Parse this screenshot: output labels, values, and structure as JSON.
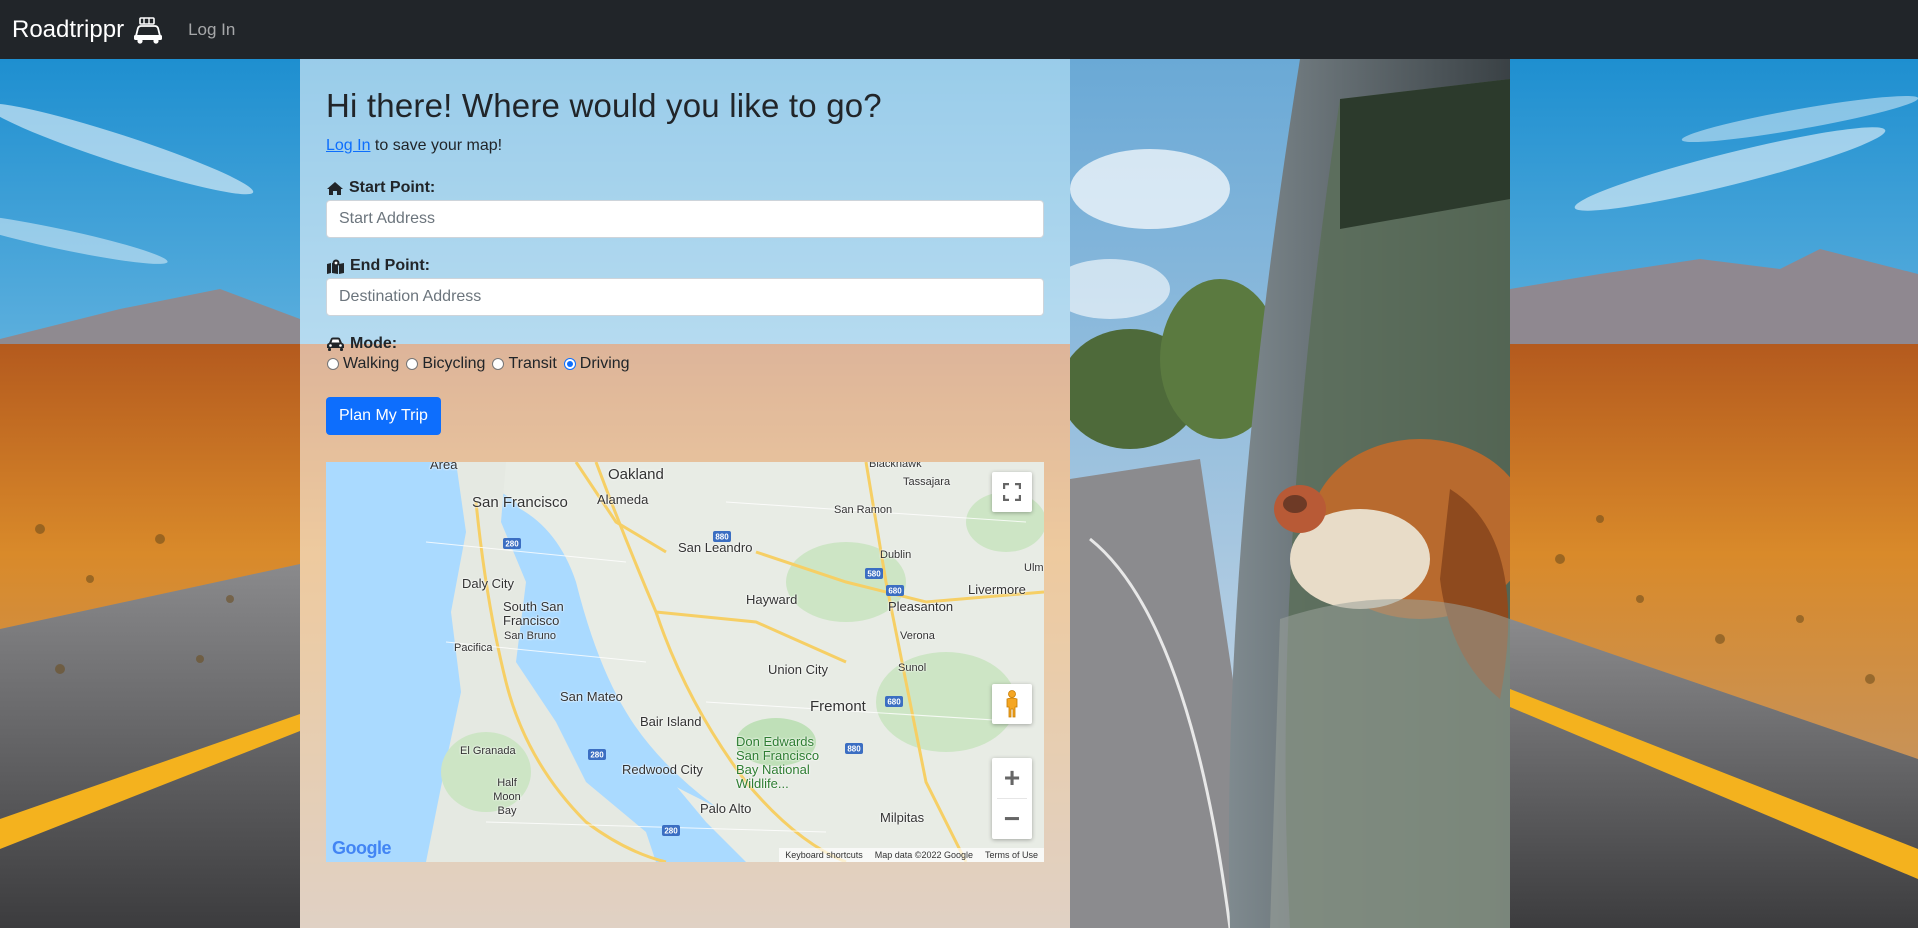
{
  "navbar": {
    "brand": "Roadtrippr",
    "brand_icon": "car-luggage-icon",
    "login_link": "Log In"
  },
  "form": {
    "heading": "Hi there! Where would you like to go?",
    "login_prompt_link": "Log In",
    "login_prompt_text": " to save your map!",
    "start_label": "Start Point:",
    "start_icon": "home-icon",
    "start_placeholder": "Start Address",
    "end_label": "End Point:",
    "end_icon": "map-marked-icon",
    "end_placeholder": "Destination Address",
    "mode_label": "Mode:",
    "mode_icon": "car-icon",
    "modes": [
      {
        "label": "Walking",
        "checked": false
      },
      {
        "label": "Bicycling",
        "checked": false
      },
      {
        "label": "Transit",
        "checked": false
      },
      {
        "label": "Driving",
        "checked": true
      }
    ],
    "submit_label": "Plan My Trip"
  },
  "map": {
    "places": [
      {
        "name": "Area"
      },
      {
        "name": "Oakland"
      },
      {
        "name": "Blackhawk"
      },
      {
        "name": "Tassajara"
      },
      {
        "name": "San Francisco"
      },
      {
        "name": "Alameda"
      },
      {
        "name": "San Ramon"
      },
      {
        "name": "San Leandro"
      },
      {
        "name": "Dublin"
      },
      {
        "name": "Daly City"
      },
      {
        "name": "Hayward"
      },
      {
        "name": "Pleasanton"
      },
      {
        "name": "Livermore"
      },
      {
        "name": "South San Francisco"
      },
      {
        "name": "San Bruno"
      },
      {
        "name": "Verona"
      },
      {
        "name": "Pacifica"
      },
      {
        "name": "Union City"
      },
      {
        "name": "Sunol"
      },
      {
        "name": "San Mateo"
      },
      {
        "name": "Fremont"
      },
      {
        "name": "Bair Island"
      },
      {
        "name": "Don Edwards San Francisco Bay National Wildlife..."
      },
      {
        "name": "El Granada"
      },
      {
        "name": "Redwood City"
      },
      {
        "name": "Half Moon Bay"
      },
      {
        "name": "Palo Alto"
      },
      {
        "name": "Milpitas"
      },
      {
        "name": "Ulm"
      }
    ],
    "footer_shortcuts": "Keyboard shortcuts",
    "footer_data": "Map data ©2022 Google",
    "footer_terms": "Terms of Use",
    "logo": "Google",
    "fullscreen_icon": "fullscreen-icon",
    "pegman_icon": "street-view-pegman-icon",
    "zoom_in": "+",
    "zoom_out": "−"
  }
}
